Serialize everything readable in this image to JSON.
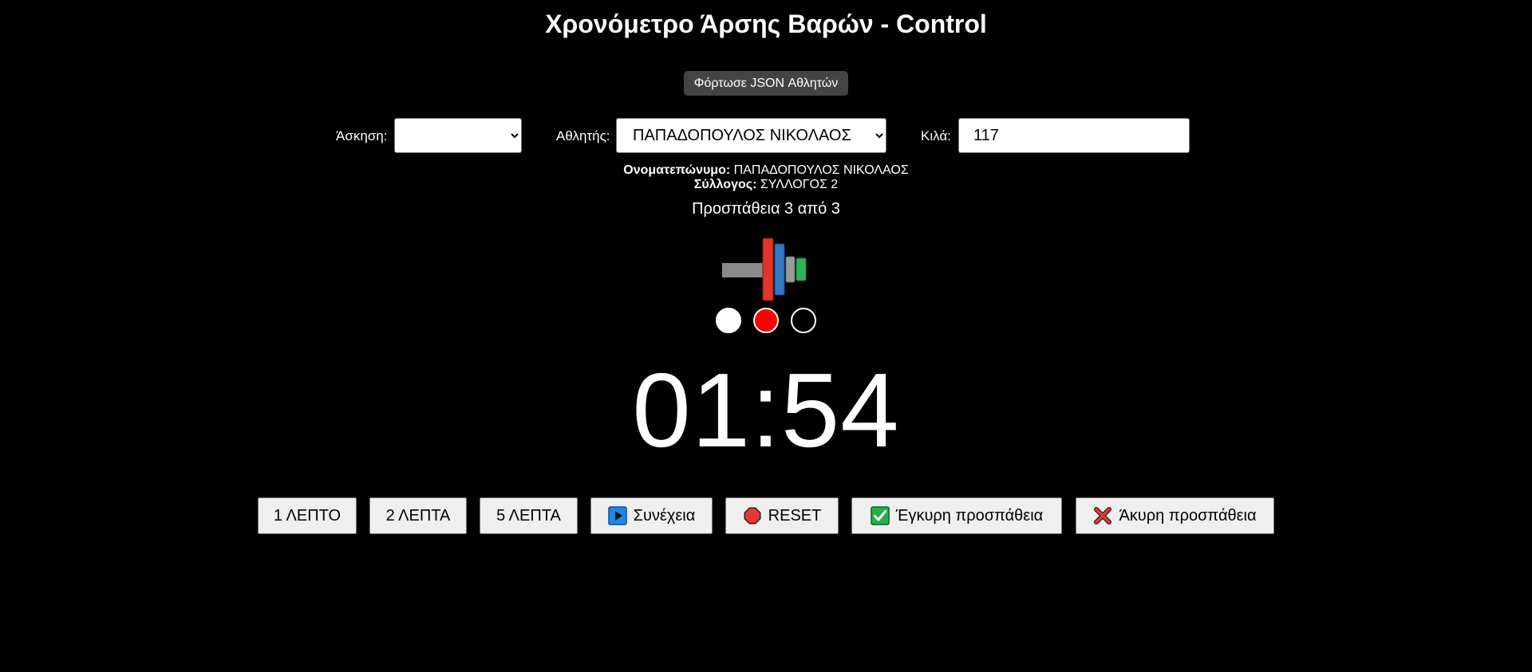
{
  "title": "Χρονόμετρο Άρσης Βαρών - Control",
  "load_button": "Φόρτωσε JSON Αθλητών",
  "exercise": {
    "label": "Άσκηση:",
    "selected": ""
  },
  "athlete": {
    "label": "Αθλητής:",
    "selected": "ΠΑΠΑΔΟΠΟΥΛΟΣ ΝΙΚΟΛΑΟΣ"
  },
  "kilos": {
    "label": "Κιλά:",
    "value": "117"
  },
  "info": {
    "name_label": "Ονοματεπώνυμο:",
    "name_value": "ΠΑΠΑΔΟΠΟΥΛΟΣ ΝΙΚΟΛΑΟΣ",
    "club_label": "Σύλλογος:",
    "club_value": "ΣΥΛΛΟΓΟΣ 2"
  },
  "attempt": "Προσπάθεια 3 από 3",
  "judge_lights": [
    {
      "color": "#ffffff"
    },
    {
      "color": "#ff0000"
    },
    {
      "color": "#000000"
    }
  ],
  "timer": "01:54",
  "buttons": {
    "one_min": "1 ΛΕΠΤΟ",
    "two_min": "2 ΛΕΠΤΑ",
    "five_min": "5 ΛΕΠΤΑ",
    "continue": "Συνέχεια",
    "reset": "RESET",
    "valid": "Έγκυρη προσπάθεια",
    "invalid": "Άκυρη προσπάθεια"
  },
  "icons": {
    "continue": "play-icon",
    "reset": "stop-sign-icon",
    "valid": "check-mark-icon",
    "invalid": "cross-mark-icon"
  },
  "colors": {
    "background": "#000000",
    "plate_red": "#e0352b",
    "plate_blue": "#2f78c4",
    "plate_gray": "#9a9a9a",
    "plate_green": "#2fb35a",
    "play_blue": "#1e88e5",
    "check_green": "#22b14c"
  }
}
